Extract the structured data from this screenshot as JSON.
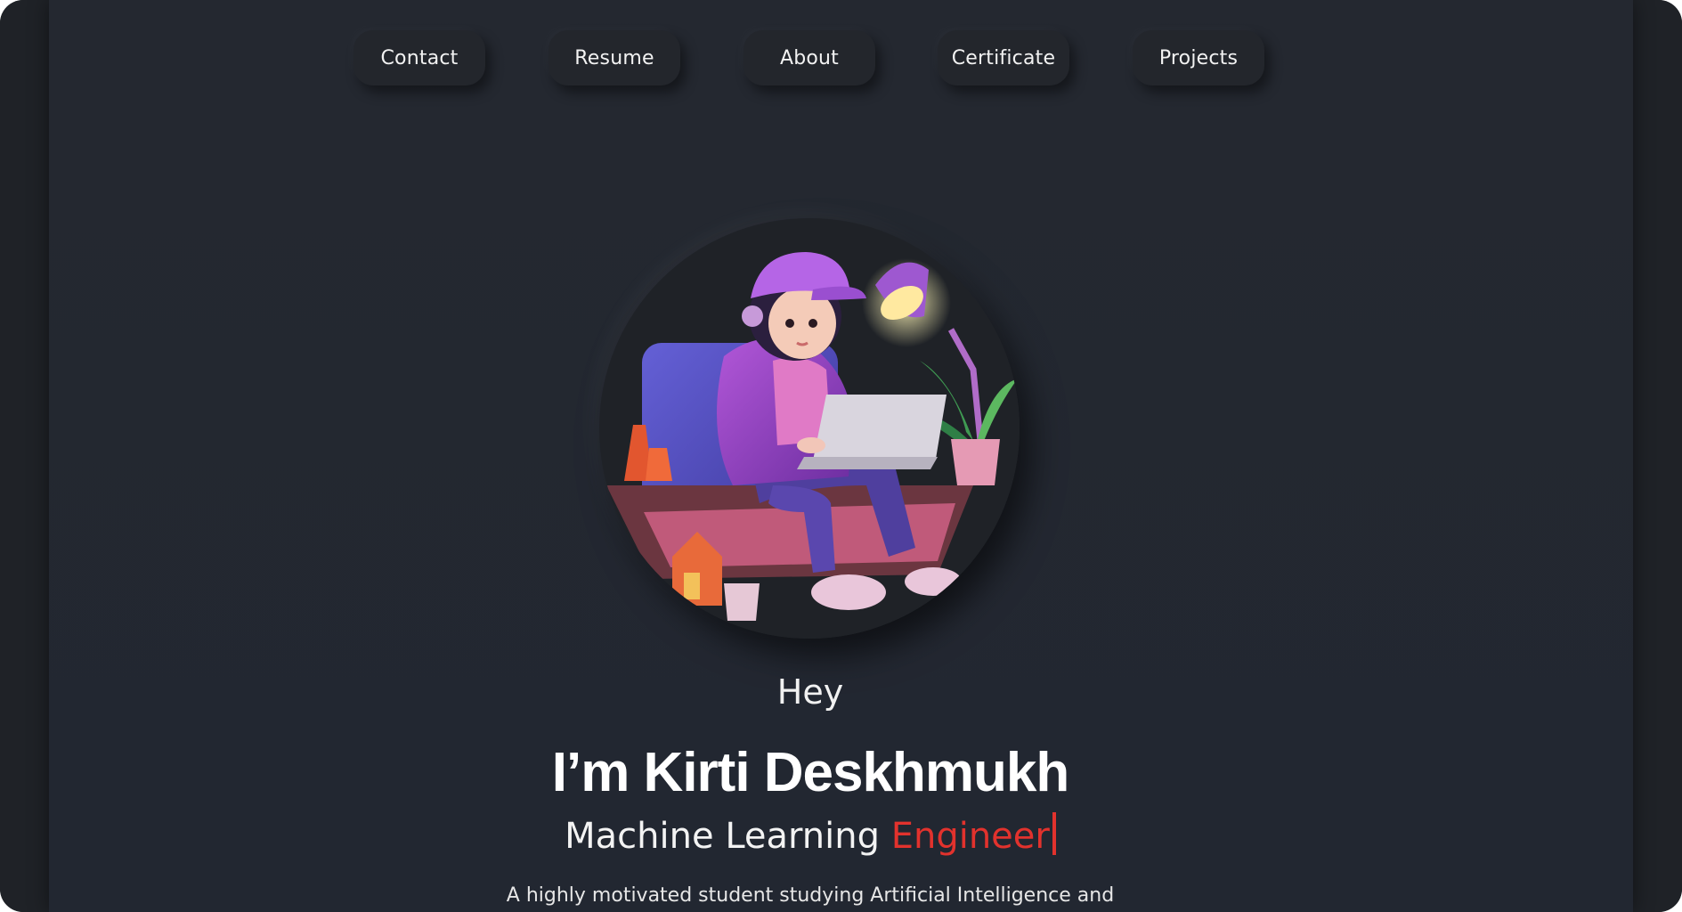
{
  "nav": {
    "items": [
      {
        "label": "Contact"
      },
      {
        "label": "Resume"
      },
      {
        "label": "About"
      },
      {
        "label": "Certificate"
      },
      {
        "label": "Projects"
      }
    ]
  },
  "hero": {
    "greeting": "Hey",
    "name": "I’m Kirti Deskhmukh",
    "role_prefix": "Machine Learning",
    "role_highlight": "Engineer",
    "description": "A highly motivated student studying Artificial Intelligence and"
  },
  "colors": {
    "background": "#242830",
    "accent": "#e2322d",
    "text": "#f3f3f3"
  }
}
